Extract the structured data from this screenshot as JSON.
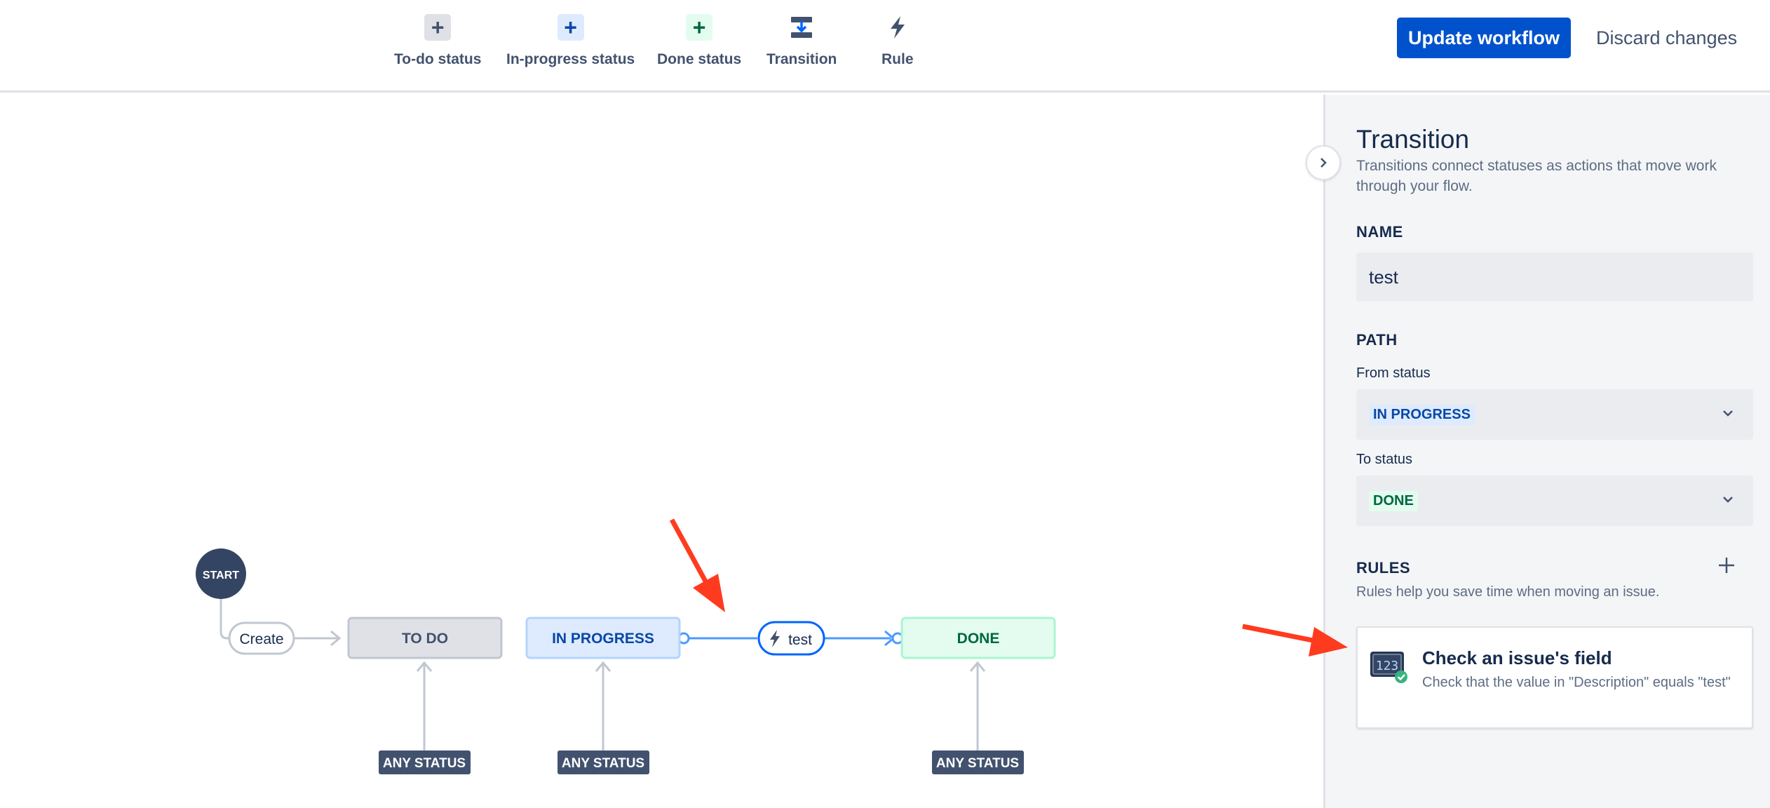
{
  "toolbar": {
    "tools": [
      {
        "label": "To-do status",
        "icon": "plus-icon"
      },
      {
        "label": "In-progress status",
        "icon": "plus-icon"
      },
      {
        "label": "Done status",
        "icon": "plus-icon"
      },
      {
        "label": "Transition",
        "icon": "transition-icon"
      },
      {
        "label": "Rule",
        "icon": "lightning-icon"
      }
    ],
    "update_label": "Update workflow",
    "discard_label": "Discard changes"
  },
  "diagram": {
    "start_label": "START",
    "create_label": "Create",
    "statuses": [
      {
        "label": "TO DO",
        "category": "todo"
      },
      {
        "label": "IN PROGRESS",
        "category": "in-progress"
      },
      {
        "label": "DONE",
        "category": "done"
      }
    ],
    "transition_label": "test",
    "any_status_label": "ANY STATUS"
  },
  "panel": {
    "title": "Transition",
    "description": "Transitions connect statuses as actions that move work through your flow.",
    "name_heading": "NAME",
    "name_value": "test",
    "path_heading": "PATH",
    "from_label": "From status",
    "from_value": "IN PROGRESS",
    "to_label": "To status",
    "to_value": "DONE",
    "rules_heading": "RULES",
    "rules_description": "Rules help you save time when moving an issue.",
    "rule": {
      "title": "Check an issue's field",
      "description": "Check that the value in \"Description\" equals \"test\"",
      "icon": "field-check-icon"
    }
  },
  "colors": {
    "primary": "#0052cc",
    "todo_bg": "#dfe1e6",
    "progress_bg": "#deebff",
    "progress_text": "#0747a6",
    "done_bg": "#e3fcef",
    "done_text": "#006644",
    "annotation_arrow": "#ff3b1f"
  }
}
